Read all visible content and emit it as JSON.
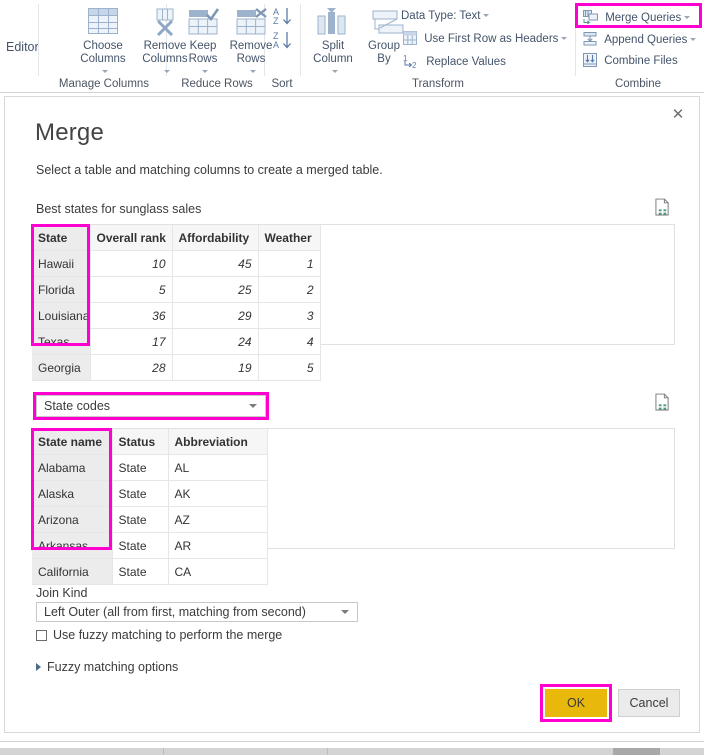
{
  "ribbon": {
    "editor_word": "Editor",
    "buttons": [
      {
        "name": "choose-columns",
        "label_line1": "Choose",
        "label_line2": "Columns",
        "has_caret": true
      },
      {
        "name": "remove-columns",
        "label_line1": "Remove",
        "label_line2": "Columns",
        "has_caret": true
      },
      {
        "name": "keep-rows",
        "label_line1": "Keep",
        "label_line2": "Rows",
        "has_caret": true
      },
      {
        "name": "remove-rows",
        "label_line1": "Remove",
        "label_line2": "Rows",
        "has_caret": true
      },
      {
        "name": "split-column",
        "label_line1": "Split",
        "label_line2": "Column",
        "has_caret": true
      },
      {
        "name": "group-by",
        "label_line1": "Group",
        "label_line2": "By",
        "has_caret": false
      }
    ],
    "transform_items": [
      {
        "name": "data-type",
        "label": "Data Type: Text",
        "has_caret": true
      },
      {
        "name": "use-first-row-as-headers",
        "label": "Use First Row as Headers",
        "has_caret": true
      },
      {
        "name": "replace-values",
        "label": "Replace Values",
        "has_caret": false
      }
    ],
    "combine_items": [
      {
        "name": "merge-queries",
        "label": "Merge Queries",
        "has_caret": true,
        "highlighted": true
      },
      {
        "name": "append-queries",
        "label": "Append Queries",
        "has_caret": true,
        "highlighted": false
      },
      {
        "name": "combine-files",
        "label": "Combine Files",
        "has_caret": false,
        "highlighted": false
      }
    ],
    "groups": [
      {
        "name": "manage-columns",
        "label": "Manage Columns"
      },
      {
        "name": "reduce-rows",
        "label": "Reduce Rows"
      },
      {
        "name": "sort",
        "label": "Sort"
      },
      {
        "name": "transform",
        "label": "Transform"
      },
      {
        "name": "combine",
        "label": "Combine"
      }
    ],
    "sort_az": "A Z",
    "sort_za": "Z A"
  },
  "dialog": {
    "title": "Merge",
    "subtitle": "Select a table and matching columns to create a merged table.",
    "close_label": "✕",
    "first_table_caption": "Best states for sunglass sales",
    "second_table_selector": "State codes",
    "first_table": {
      "columns": [
        "State",
        "Overall rank",
        "Affordability",
        "Weather"
      ],
      "selected_column": "State",
      "rows": [
        [
          "Hawaii",
          "10",
          "45",
          "1"
        ],
        [
          "Florida",
          "5",
          "25",
          "2"
        ],
        [
          "Louisiana",
          "36",
          "29",
          "3"
        ],
        [
          "Texas",
          "17",
          "24",
          "4"
        ],
        [
          "Georgia",
          "28",
          "19",
          "5"
        ]
      ]
    },
    "second_table": {
      "columns": [
        "State name",
        "Status",
        "Abbreviation"
      ],
      "selected_column": "State name",
      "rows": [
        [
          "Alabama",
          "State",
          "AL"
        ],
        [
          "Alaska",
          "State",
          "AK"
        ],
        [
          "Arizona",
          "State",
          "AZ"
        ],
        [
          "Arkansas",
          "State",
          "AR"
        ],
        [
          "California",
          "State",
          "CA"
        ]
      ]
    },
    "join_kind_label": "Join Kind",
    "join_kind_value": "Left Outer (all from first, matching from second)",
    "fuzzy_checkbox_label": "Use fuzzy matching to perform the merge",
    "fuzzy_options_label": "Fuzzy matching options",
    "ok_label": "OK",
    "cancel_label": "Cancel"
  },
  "colors": {
    "highlight": "#ff00d0",
    "primary_button": "#e8b80b",
    "icon_blue": "#9db3cd",
    "text": "#3b3b3b"
  }
}
